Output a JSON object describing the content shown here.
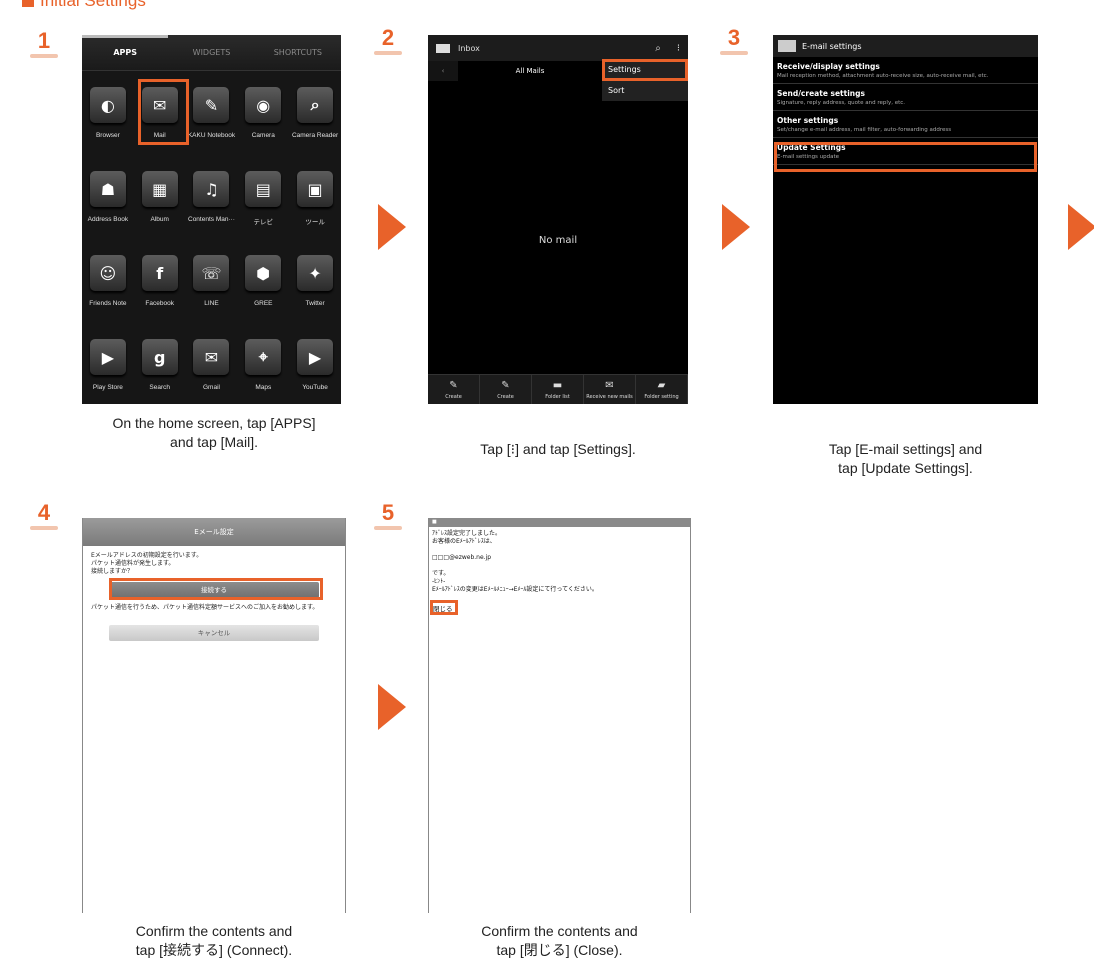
{
  "section_title": "Initial Settings",
  "steps": [
    {
      "num": "1",
      "caption_l1": "On the home screen, tap [APPS]",
      "caption_l2": "and tap [Mail]."
    },
    {
      "num": "2",
      "caption_l1": "Tap [⁝] and tap [Settings].",
      "caption_l2": ""
    },
    {
      "num": "3",
      "caption_l1": "Tap [E-mail settings] and",
      "caption_l2": "tap [Update Settings]."
    },
    {
      "num": "4",
      "caption_l1": "Confirm the contents and",
      "caption_l2": "tap [接続する] (Connect)."
    },
    {
      "num": "5",
      "caption_l1": "Confirm the contents and",
      "caption_l2": "tap [閉じる] (Close)."
    }
  ],
  "screen1": {
    "tabs": [
      "APPS",
      "WIDGETS",
      "SHORTCUTS"
    ],
    "apps": [
      {
        "label": "Browser",
        "glyph": "◐"
      },
      {
        "label": "Mail",
        "glyph": "✉"
      },
      {
        "label": "KAKU Notebook",
        "glyph": "✎"
      },
      {
        "label": "Camera",
        "glyph": "◉"
      },
      {
        "label": "Camera Reader",
        "glyph": "⌕"
      },
      {
        "label": "Address Book",
        "glyph": "☗"
      },
      {
        "label": "Album",
        "glyph": "▦"
      },
      {
        "label": "Contents Man···",
        "glyph": "♫"
      },
      {
        "label": "テレビ",
        "glyph": "▤"
      },
      {
        "label": "ツール",
        "glyph": "▣"
      },
      {
        "label": "Friends Note",
        "glyph": "☺"
      },
      {
        "label": "Facebook",
        "glyph": "f"
      },
      {
        "label": "LINE",
        "glyph": "☏"
      },
      {
        "label": "GREE",
        "glyph": "⬢"
      },
      {
        "label": "Twitter",
        "glyph": "✦"
      },
      {
        "label": "Play Store",
        "glyph": "▶"
      },
      {
        "label": "Search",
        "glyph": "g"
      },
      {
        "label": "Gmail",
        "glyph": "✉"
      },
      {
        "label": "Maps",
        "glyph": "⌖"
      },
      {
        "label": "YouTube",
        "glyph": "▶"
      },
      {
        "label": "",
        "glyph": "▭"
      },
      {
        "label": "",
        "glyph": "◎"
      },
      {
        "label": "",
        "glyph": "◉"
      },
      {
        "label": "",
        "glyph": "▯"
      },
      {
        "label": "",
        "glyph": "◌"
      }
    ]
  },
  "screen2": {
    "title": "Inbox",
    "tab": "All Mails",
    "empty": "No mail",
    "menu": [
      "Settings",
      "Sort"
    ],
    "bottom": [
      "Create",
      "Create",
      "Folder list",
      "Receive new mails",
      "Folder setting"
    ]
  },
  "screen3": {
    "title": "E-mail settings",
    "items": [
      {
        "title": "Receive/display settings",
        "desc": "Mail reception method, attachment auto-receive size, auto-receive mail, etc."
      },
      {
        "title": "Send/create settings",
        "desc": "Signature, reply address, quote and reply, etc."
      },
      {
        "title": "Other settings",
        "desc": "Set/change e-mail address, mail filter, auto-forwarding address"
      },
      {
        "title": "Update Settings",
        "desc": "E-mail settings update"
      }
    ]
  },
  "screen4": {
    "title": "Eメール設定",
    "line1": "Eメールアドレスの初期設定を行います。",
    "line2": "パケット通信料が発生します。",
    "line3": "接続しますか？",
    "connect": "接続する",
    "note": "パケット通信を行うため、パケット通信料定額サービスへのご加入をお勧めします。",
    "cancel": "キャンセル"
  },
  "screen5": {
    "line1": "ｱﾄﾞﾚｽ設定完了しました。",
    "line2": "お客様のEﾒｰﾙｱﾄﾞﾚｽは、",
    "line3": "□□□@ezweb.ne.jp",
    "line4": "です。",
    "line5": "-ﾋﾝﾄ-",
    "line6": "Eﾒｰﾙｱﾄﾞﾚｽの変更はEﾒｰﾙﾒﾆｭｰ→Eﾒｰﾙ設定にて行ってください。",
    "close": "閉じる"
  }
}
